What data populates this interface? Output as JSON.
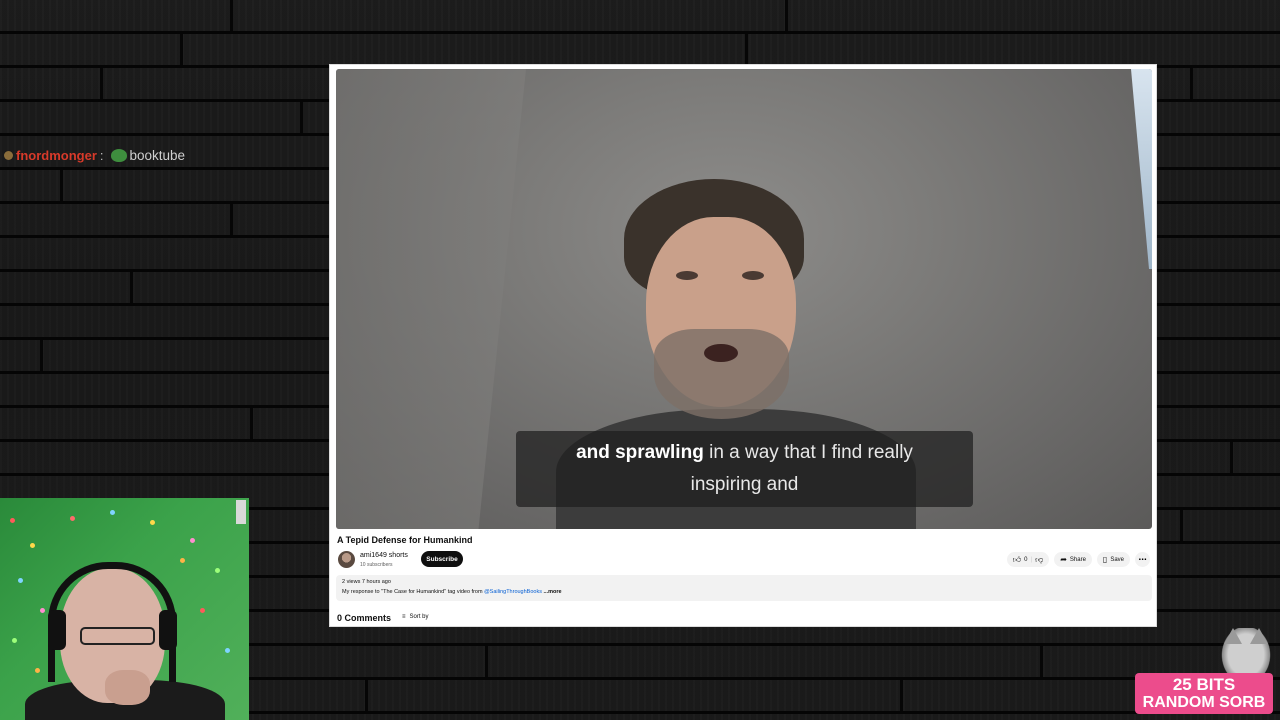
{
  "chat": {
    "username": "fnordmonger",
    "separator": ":",
    "message": "booktube"
  },
  "video": {
    "caption_bold": "and sprawling",
    "caption_rest_line1": " in a way that I find really",
    "caption_line2": "inspiring and",
    "title": "A Tepid Defense for Humankind"
  },
  "channel": {
    "name": "ami1649 shorts",
    "subscribers": "10 subscribers",
    "subscribe_label": "Subscribe"
  },
  "actions": {
    "like_count": "0",
    "share_label": "Share",
    "save_label": "Save",
    "more_label": "⋯"
  },
  "description": {
    "meta": "2 views  7 hours ago",
    "text_prefix": "My response to \"The Case for Humankind\" tag video from ",
    "link": "@SailingThroughBooks",
    "more": " ...more"
  },
  "comments": {
    "count_label": "0 Comments",
    "sort_label": "Sort by"
  },
  "alert": {
    "line1": "25 BITS",
    "line2": "RANDOM SORB"
  },
  "colors": {
    "chat_user": "#d83a2a",
    "alert_bg": "#ec4c8c",
    "link": "#065fd4"
  },
  "icons": [
    "chat-badge-icon",
    "frog-emote-icon",
    "thumbs-up-icon",
    "thumbs-down-icon",
    "share-icon",
    "save-icon",
    "sort-icon",
    "more-icon"
  ]
}
